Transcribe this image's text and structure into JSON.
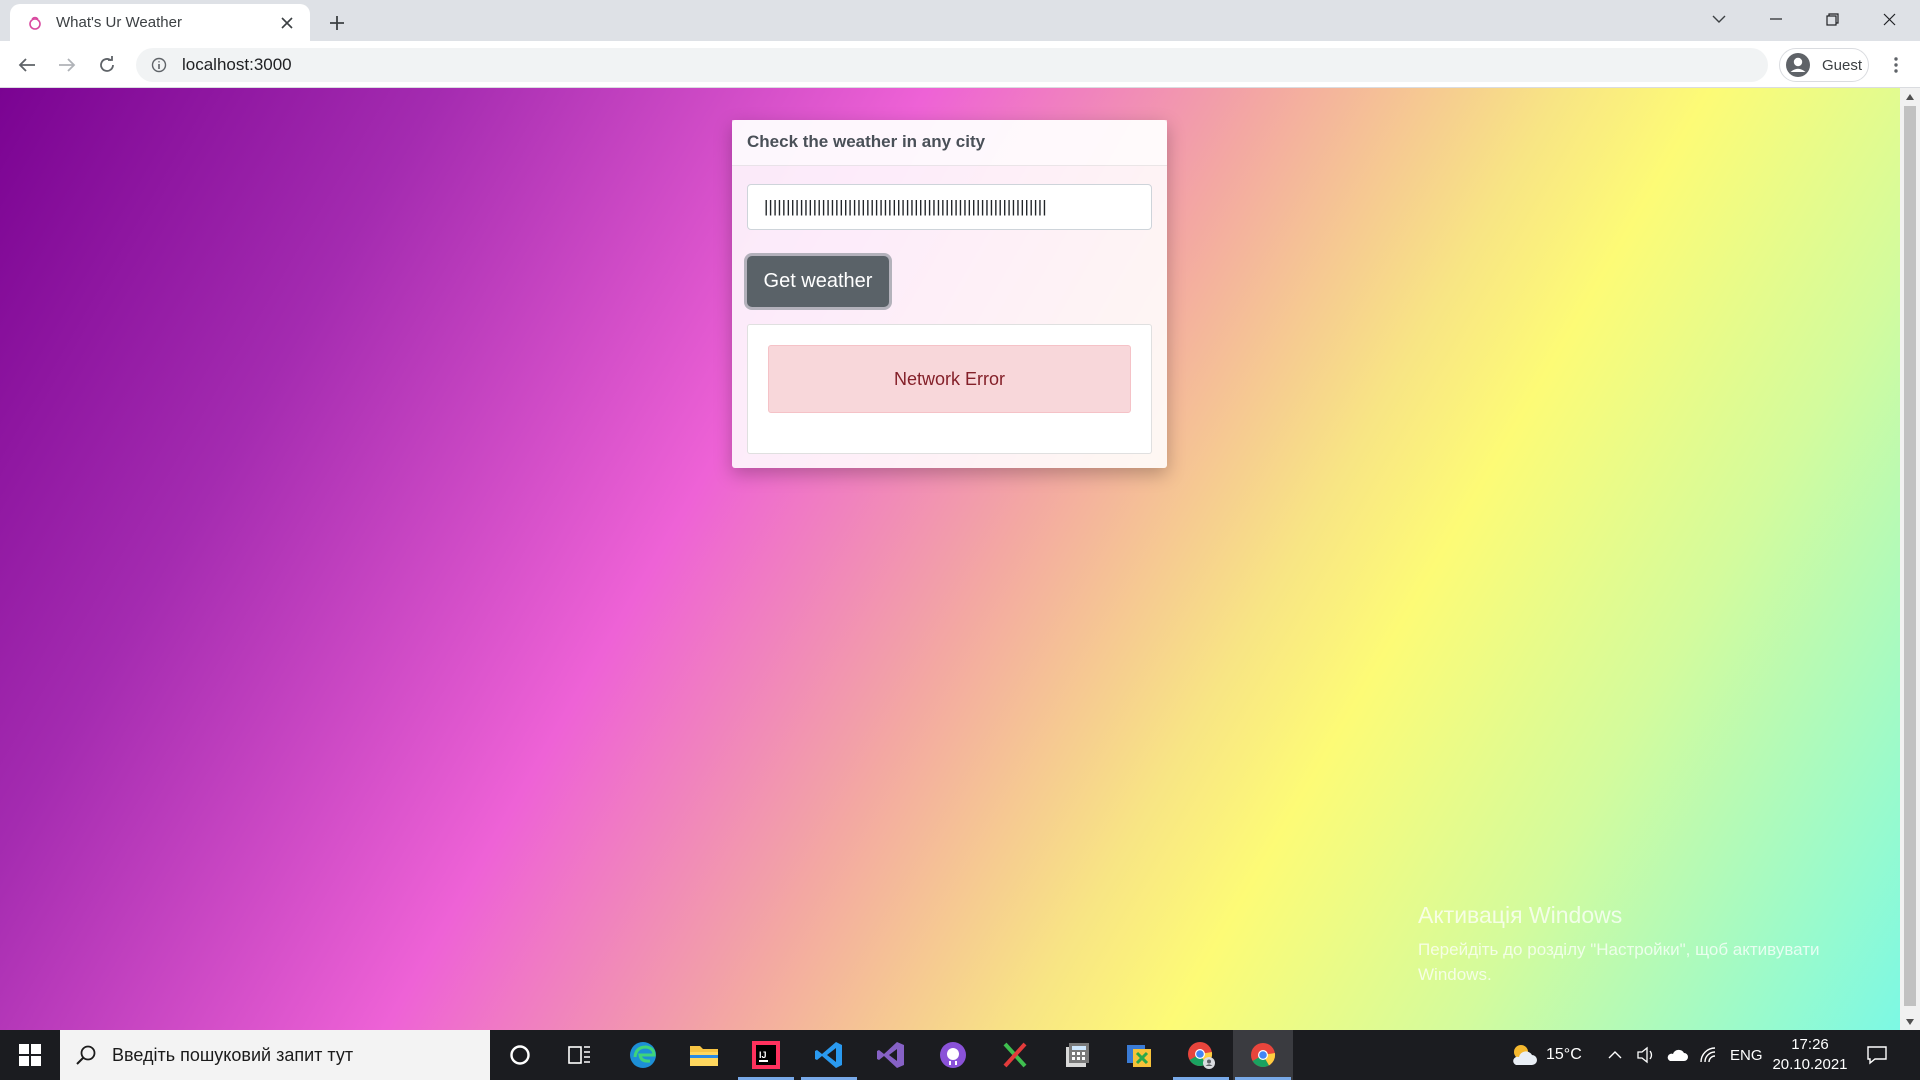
{
  "browser": {
    "tab_title": "What's Ur Weather",
    "url": "localhost:3000",
    "profile_label": "Guest"
  },
  "app": {
    "card_title": "Check the weather in any city",
    "city_input_value": "||||||||||||||||||||||||||||||||||||||||||||||||||||||||||||||||",
    "button_label": "Get weather",
    "error_message": "Network Error"
  },
  "watermark": {
    "title": "Активація Windows",
    "text": "Перейдіть до розділу \"Настройки\", щоб активувати Windows."
  },
  "taskbar": {
    "search_placeholder": "Введіть пошуковий запит тут",
    "weather_temp": "15°C",
    "language": "ENG",
    "time": "17:26",
    "date": "20.10.2021",
    "apps": [
      "cortana-icon",
      "task-view-icon",
      "edge-icon",
      "file-explorer-icon",
      "intellij-icon",
      "vscode-icon",
      "visual-studio-icon",
      "github-desktop-icon",
      "xmind-icon",
      "calculator-icon",
      "fiddler-icon",
      "chrome-guest-icon",
      "chrome-icon"
    ]
  },
  "colors": {
    "accent_button": "#5a6268",
    "alert_bg": "#f8d7da",
    "alert_text": "#842029"
  }
}
